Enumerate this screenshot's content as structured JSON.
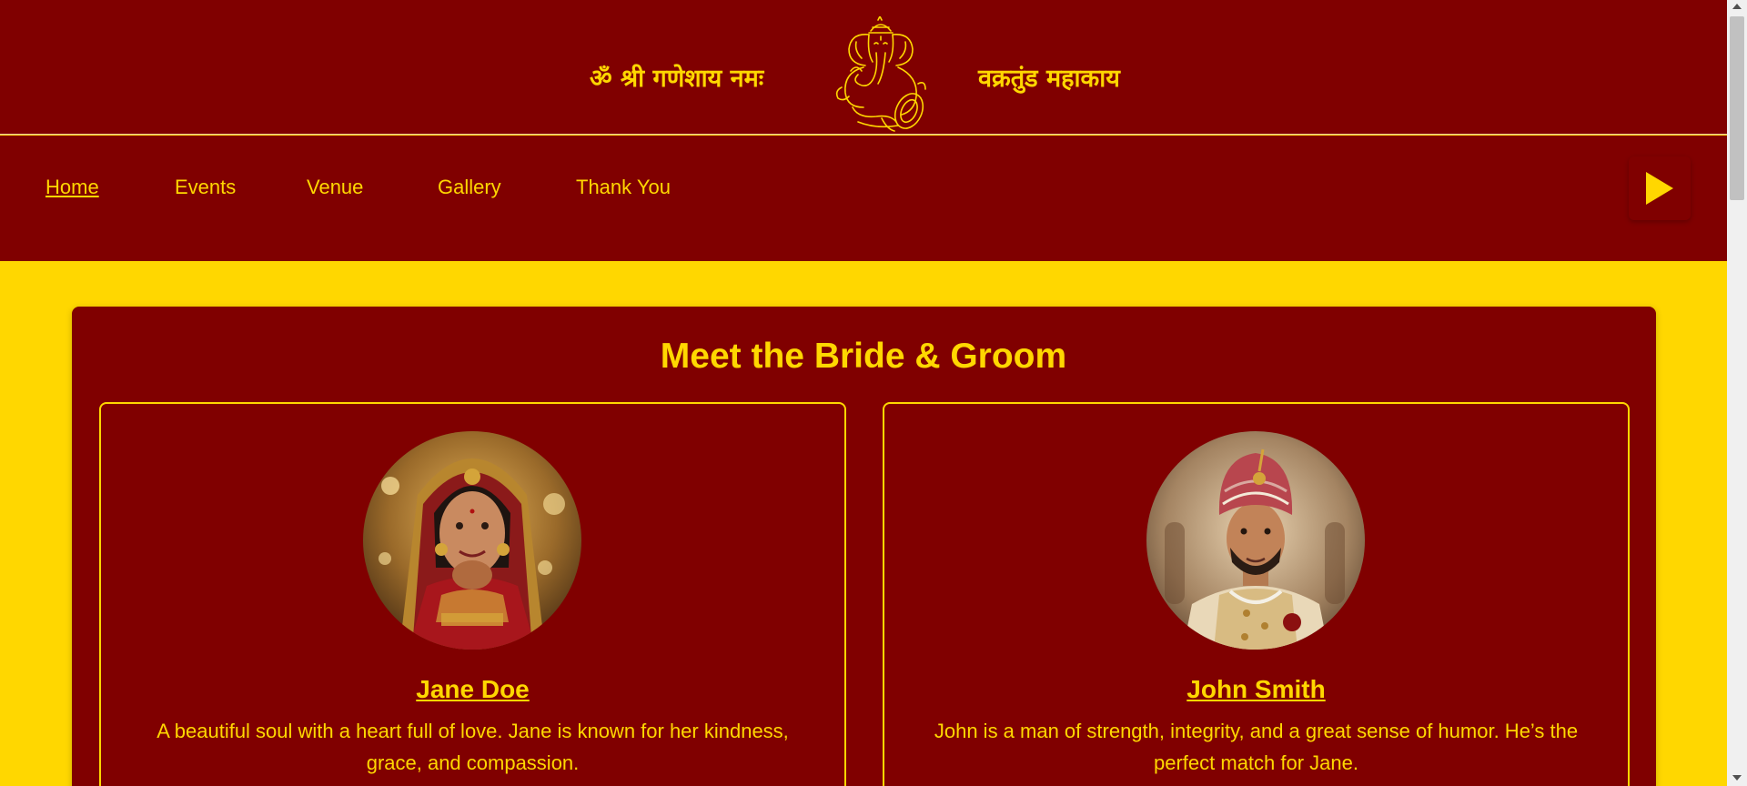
{
  "header": {
    "mantra_left": "ॐ श्री गणेशाय नमः",
    "mantra_right": "वक्रतुंड महाकाय",
    "logo_icon": "ganesha-icon"
  },
  "nav": {
    "items": [
      {
        "label": "Home",
        "active": true
      },
      {
        "label": "Events",
        "active": false
      },
      {
        "label": "Venue",
        "active": false
      },
      {
        "label": "Gallery",
        "active": false
      },
      {
        "label": "Thank You",
        "active": false
      }
    ],
    "play_icon": "play-icon"
  },
  "main": {
    "title": "Meet the Bride & Groom",
    "bride": {
      "name": "Jane Doe",
      "bio_line1": "A beautiful soul with a heart full of love. Jane is known for her kindness,",
      "bio_line2": "grace, and compassion."
    },
    "groom": {
      "name": "John Smith",
      "bio_line1": "John is a man of strength, integrity, and a great sense of humor. He’s the",
      "bio_line2": "perfect match for Jane."
    }
  },
  "colors": {
    "maroon": "#800000",
    "gold": "#ffd700"
  }
}
